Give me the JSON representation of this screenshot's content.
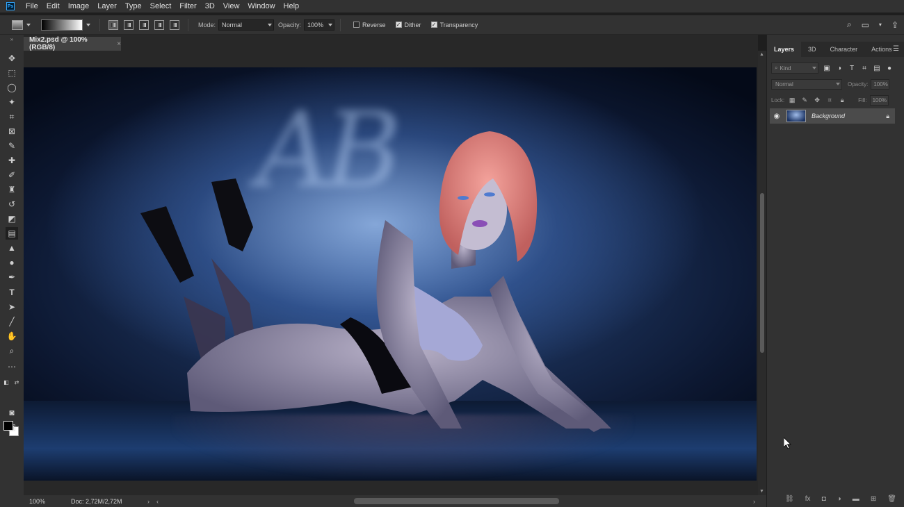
{
  "app": {
    "logo_text": "Ps",
    "brand_color": "#31a8ff"
  },
  "menu": [
    "File",
    "Edit",
    "Image",
    "Layer",
    "Type",
    "Select",
    "Filter",
    "3D",
    "View",
    "Window",
    "Help"
  ],
  "options": {
    "mode_label": "Mode:",
    "mode_value": "Normal",
    "opacity_label": "Opacity:",
    "opacity_value": "100%",
    "reverse_label": "Reverse",
    "reverse_checked": false,
    "dither_label": "Dither",
    "dither_checked": true,
    "transparency_label": "Transparency",
    "transparency_checked": true
  },
  "document": {
    "tab_title": "Mix2.psd @ 100% (RGB/8)",
    "close_glyph": "×"
  },
  "status": {
    "zoom": "100%",
    "doc_size": "Doc: 2,72M/2,72M"
  },
  "panels": {
    "tabs": [
      "Layers",
      "3D",
      "Character",
      "Actions"
    ],
    "active_tab": "Layers",
    "kind_placeholder": "Kind",
    "blend_mode": "Normal",
    "opacity_label": "Opacity:",
    "opacity_value": "100%",
    "lock_label": "Lock:",
    "fill_label": "Fill:",
    "fill_value": "100%",
    "layers": [
      {
        "name": "Background",
        "visible": true,
        "locked": true
      }
    ]
  },
  "colors": {
    "foreground": "#000000",
    "background": "#ffffff"
  }
}
